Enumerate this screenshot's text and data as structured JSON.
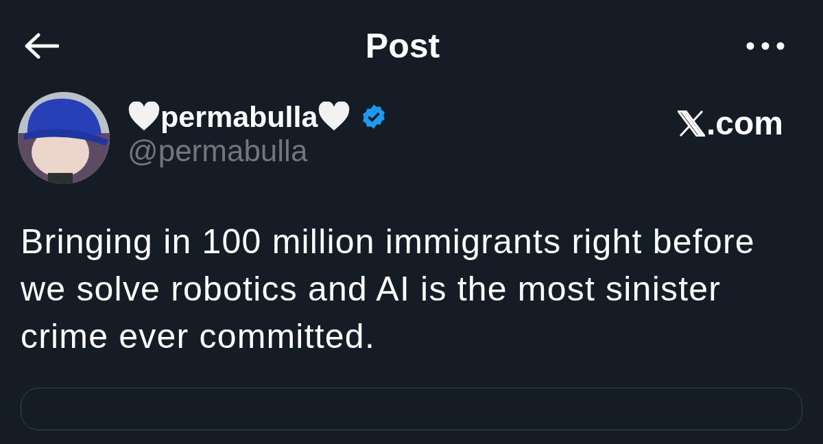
{
  "header": {
    "title": "Post"
  },
  "author": {
    "display_name": "permabulla",
    "heart_before": true,
    "heart_after": true,
    "verified": true,
    "handle": "@permabulla"
  },
  "source_label": ".com",
  "post": {
    "text": "Bringing in 100 million immigrants right before we solve robotics and AI is the most sinister crime ever committed."
  }
}
